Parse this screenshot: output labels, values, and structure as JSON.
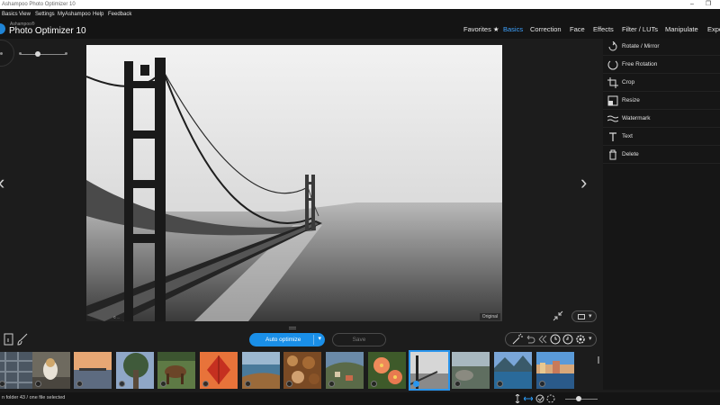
{
  "window": {
    "title": "Ashampoo Photo Optimizer 10",
    "controls": [
      "–",
      "❐"
    ]
  },
  "menu": [
    "Basics",
    "View",
    "Settings",
    "MyAshampoo",
    "Help",
    "Feedback"
  ],
  "brand": {
    "small": "Ashampoo®",
    "title": "Photo Optimizer 10",
    "accent": "#1f84d6"
  },
  "tabs": [
    {
      "label": "Favorites ★",
      "active": false
    },
    {
      "label": "Basics",
      "active": true
    },
    {
      "label": "Correction",
      "active": false
    },
    {
      "label": "Face",
      "active": false
    },
    {
      "label": "Effects",
      "active": false
    },
    {
      "label": "Filter / LUTs",
      "active": false
    },
    {
      "label": "Manipulate",
      "active": false
    },
    {
      "label": "Expo",
      "active": false
    }
  ],
  "zoom": {
    "level": 0.35
  },
  "photo": {
    "badge": "Original",
    "watermark": "© ..."
  },
  "nav": {
    "prev": "‹",
    "next": "›"
  },
  "tools": [
    {
      "label": "Rotate / Mirror",
      "icon": "rotate-icon"
    },
    {
      "label": "Free Rotation",
      "icon": "free-rotation-icon"
    },
    {
      "label": "Crop",
      "icon": "crop-icon"
    },
    {
      "label": "Resize",
      "icon": "resize-icon"
    },
    {
      "label": "Watermark",
      "icon": "watermark-icon"
    },
    {
      "label": "Text",
      "icon": "text-icon"
    },
    {
      "label": "Delete",
      "icon": "trash-icon"
    }
  ],
  "toolbar": {
    "auto_optimize": "Auto optimize",
    "save": "Save",
    "dropdown": "▾"
  },
  "thumbnails": [
    {
      "name": "thumb-1",
      "selected": false
    },
    {
      "name": "thumb-cat",
      "selected": false
    },
    {
      "name": "thumb-sunset-pier",
      "selected": false
    },
    {
      "name": "thumb-tree",
      "selected": false
    },
    {
      "name": "thumb-horses",
      "selected": false
    },
    {
      "name": "thumb-red-leaf",
      "selected": false
    },
    {
      "name": "thumb-coast",
      "selected": false
    },
    {
      "name": "thumb-nuts",
      "selected": false
    },
    {
      "name": "thumb-village",
      "selected": false
    },
    {
      "name": "thumb-flowers",
      "selected": false
    },
    {
      "name": "thumb-bridge",
      "selected": true
    },
    {
      "name": "thumb-rocks",
      "selected": false
    },
    {
      "name": "thumb-lake",
      "selected": false
    },
    {
      "name": "thumb-harbor",
      "selected": false
    }
  ],
  "status": {
    "text": "n folder 43 / one file selected",
    "zoom_level": 0.5
  }
}
